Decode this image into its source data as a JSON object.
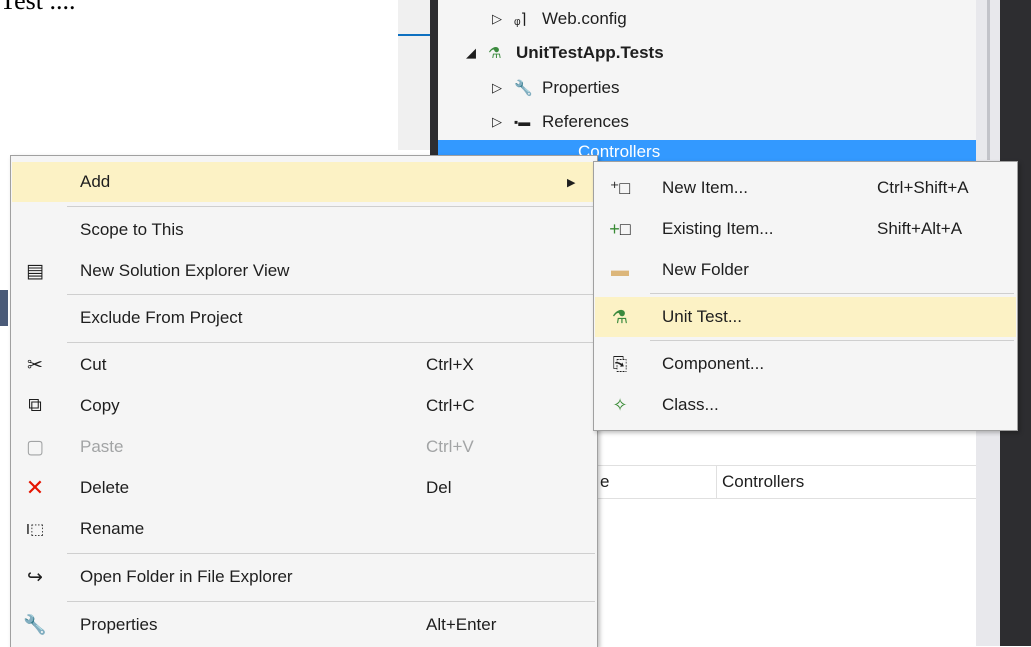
{
  "document": {
    "partial_text": "Test ...."
  },
  "explorer": {
    "items": [
      {
        "label": "Web.config",
        "icon": "config-icon"
      },
      {
        "label": "UnitTestApp.Tests",
        "icon": "test-project-icon"
      },
      {
        "label": "Properties",
        "icon": "wrench-icon"
      },
      {
        "label": "References",
        "icon": "references-icon"
      },
      {
        "label": "Controllers",
        "icon": "folder-icon"
      }
    ]
  },
  "properties_pane": {
    "col1": "e",
    "col2": "Controllers"
  },
  "context_menu": {
    "items": [
      {
        "label": "Add",
        "shortcut": "",
        "icon": "",
        "has_submenu": true
      },
      {
        "label": "Scope to This",
        "shortcut": "",
        "icon": ""
      },
      {
        "label": "New Solution Explorer View",
        "shortcut": "",
        "icon": "new-view-icon"
      },
      {
        "label": "Exclude From Project",
        "shortcut": "",
        "icon": ""
      },
      {
        "label": "Cut",
        "shortcut": "Ctrl+X",
        "icon": "scissors-icon"
      },
      {
        "label": "Copy",
        "shortcut": "Ctrl+C",
        "icon": "copy-icon"
      },
      {
        "label": "Paste",
        "shortcut": "Ctrl+V",
        "icon": "paste-icon",
        "disabled": true
      },
      {
        "label": "Delete",
        "shortcut": "Del",
        "icon": "delete-icon"
      },
      {
        "label": "Rename",
        "shortcut": "",
        "icon": "rename-icon"
      },
      {
        "label": "Open Folder in File Explorer",
        "shortcut": "",
        "icon": "open-folder-icon"
      },
      {
        "label": "Properties",
        "shortcut": "Alt+Enter",
        "icon": "wrench-icon"
      }
    ]
  },
  "add_submenu": {
    "items": [
      {
        "label": "New Item...",
        "shortcut": "Ctrl+Shift+A",
        "icon": "new-item-icon"
      },
      {
        "label": "Existing Item...",
        "shortcut": "Shift+Alt+A",
        "icon": "existing-item-icon"
      },
      {
        "label": "New Folder",
        "shortcut": "",
        "icon": "new-folder-icon"
      },
      {
        "label": "Unit Test...",
        "shortcut": "",
        "icon": "unit-test-icon"
      },
      {
        "label": "Component...",
        "shortcut": "",
        "icon": "component-icon"
      },
      {
        "label": "Class...",
        "shortcut": "",
        "icon": "class-icon"
      }
    ]
  },
  "colors": {
    "highlight": "#fcf2c5",
    "selection": "#3399ff",
    "delete_red": "#e51400",
    "menu_bg": "#f5f5f5"
  }
}
